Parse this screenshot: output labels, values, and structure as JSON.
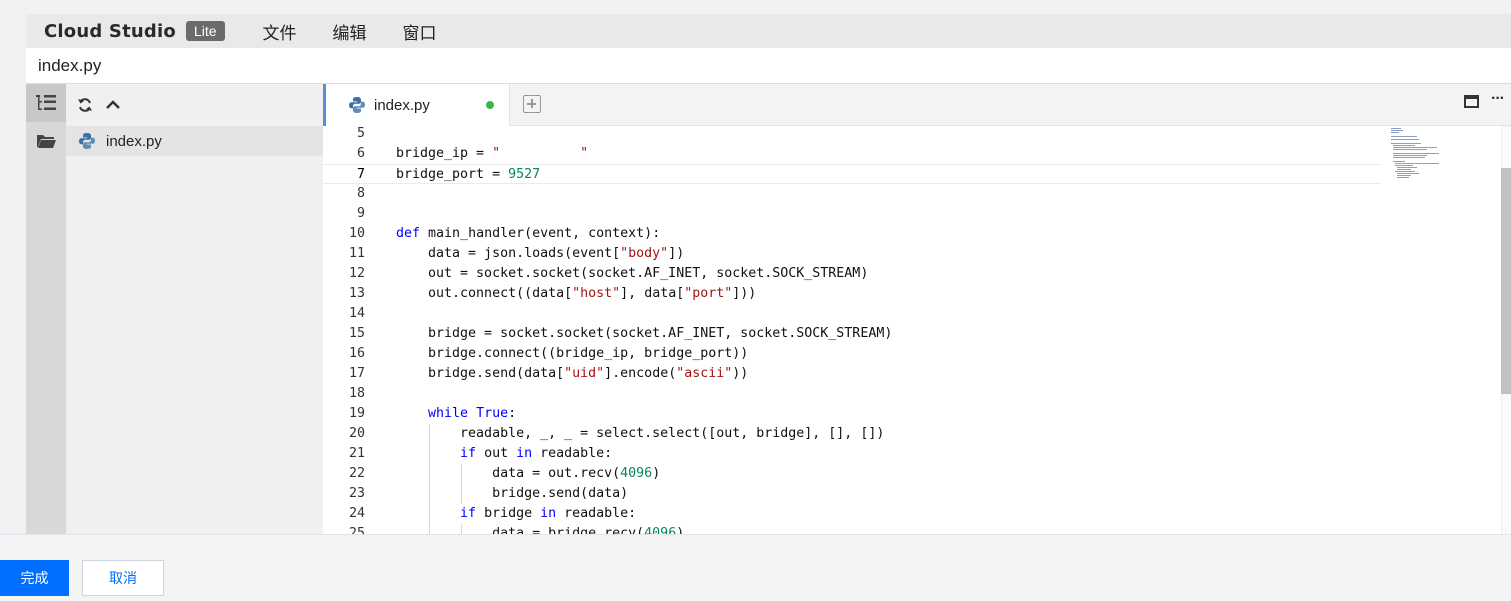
{
  "app": {
    "brand": "Cloud Studio",
    "badge": "Lite"
  },
  "menu": {
    "items": [
      "文件",
      "编辑",
      "窗口"
    ]
  },
  "filebar": {
    "filename": "index.py"
  },
  "sidebar": {
    "activity_icons": [
      "explorer-tree-icon",
      "folder-icon"
    ],
    "tool_icons": [
      "refresh-icon",
      "collapse-up-icon"
    ],
    "files": [
      {
        "name": "index.py",
        "icon": "python-icon"
      }
    ]
  },
  "editor": {
    "tabs": [
      {
        "label": "index.py",
        "status": "modified",
        "status_color": "#3ab54a"
      }
    ],
    "actions": [
      "new-tab-icon",
      "maximize-icon",
      "more-icon"
    ],
    "current_line": 7,
    "lines": [
      {
        "n": "5",
        "code": ""
      },
      {
        "n": "6",
        "code": "bridge_ip = \"          \""
      },
      {
        "n": "7",
        "code": "bridge_port = 9527"
      },
      {
        "n": "8",
        "code": ""
      },
      {
        "n": "9",
        "code": ""
      },
      {
        "n": "10",
        "code": "def main_handler(event, context):"
      },
      {
        "n": "11",
        "code": "    data = json.loads(event[\"body\"])"
      },
      {
        "n": "12",
        "code": "    out = socket.socket(socket.AF_INET, socket.SOCK_STREAM)"
      },
      {
        "n": "13",
        "code": "    out.connect((data[\"host\"], data[\"port\"]))"
      },
      {
        "n": "14",
        "code": ""
      },
      {
        "n": "15",
        "code": "    bridge = socket.socket(socket.AF_INET, socket.SOCK_STREAM)"
      },
      {
        "n": "16",
        "code": "    bridge.connect((bridge_ip, bridge_port))"
      },
      {
        "n": "17",
        "code": "    bridge.send(data[\"uid\"].encode(\"ascii\"))"
      },
      {
        "n": "18",
        "code": ""
      },
      {
        "n": "19",
        "code": "    while True:"
      },
      {
        "n": "20",
        "code": "        readable, _, _ = select.select([out, bridge], [], [])"
      },
      {
        "n": "21",
        "code": "        if out in readable:"
      },
      {
        "n": "22",
        "code": "            data = out.recv(4096)"
      },
      {
        "n": "23",
        "code": "            bridge.send(data)"
      },
      {
        "n": "24",
        "code": "        if bridge in readable:"
      },
      {
        "n": "25",
        "code": "            data = bridge.recv(4096)"
      }
    ]
  },
  "footer": {
    "confirm_label": "完成",
    "cancel_label": "取消"
  },
  "colors": {
    "accent": "#006eff",
    "keyword": "#0000ff",
    "string": "#a31515",
    "number": "#098658",
    "modified_dot": "#3ab54a"
  }
}
